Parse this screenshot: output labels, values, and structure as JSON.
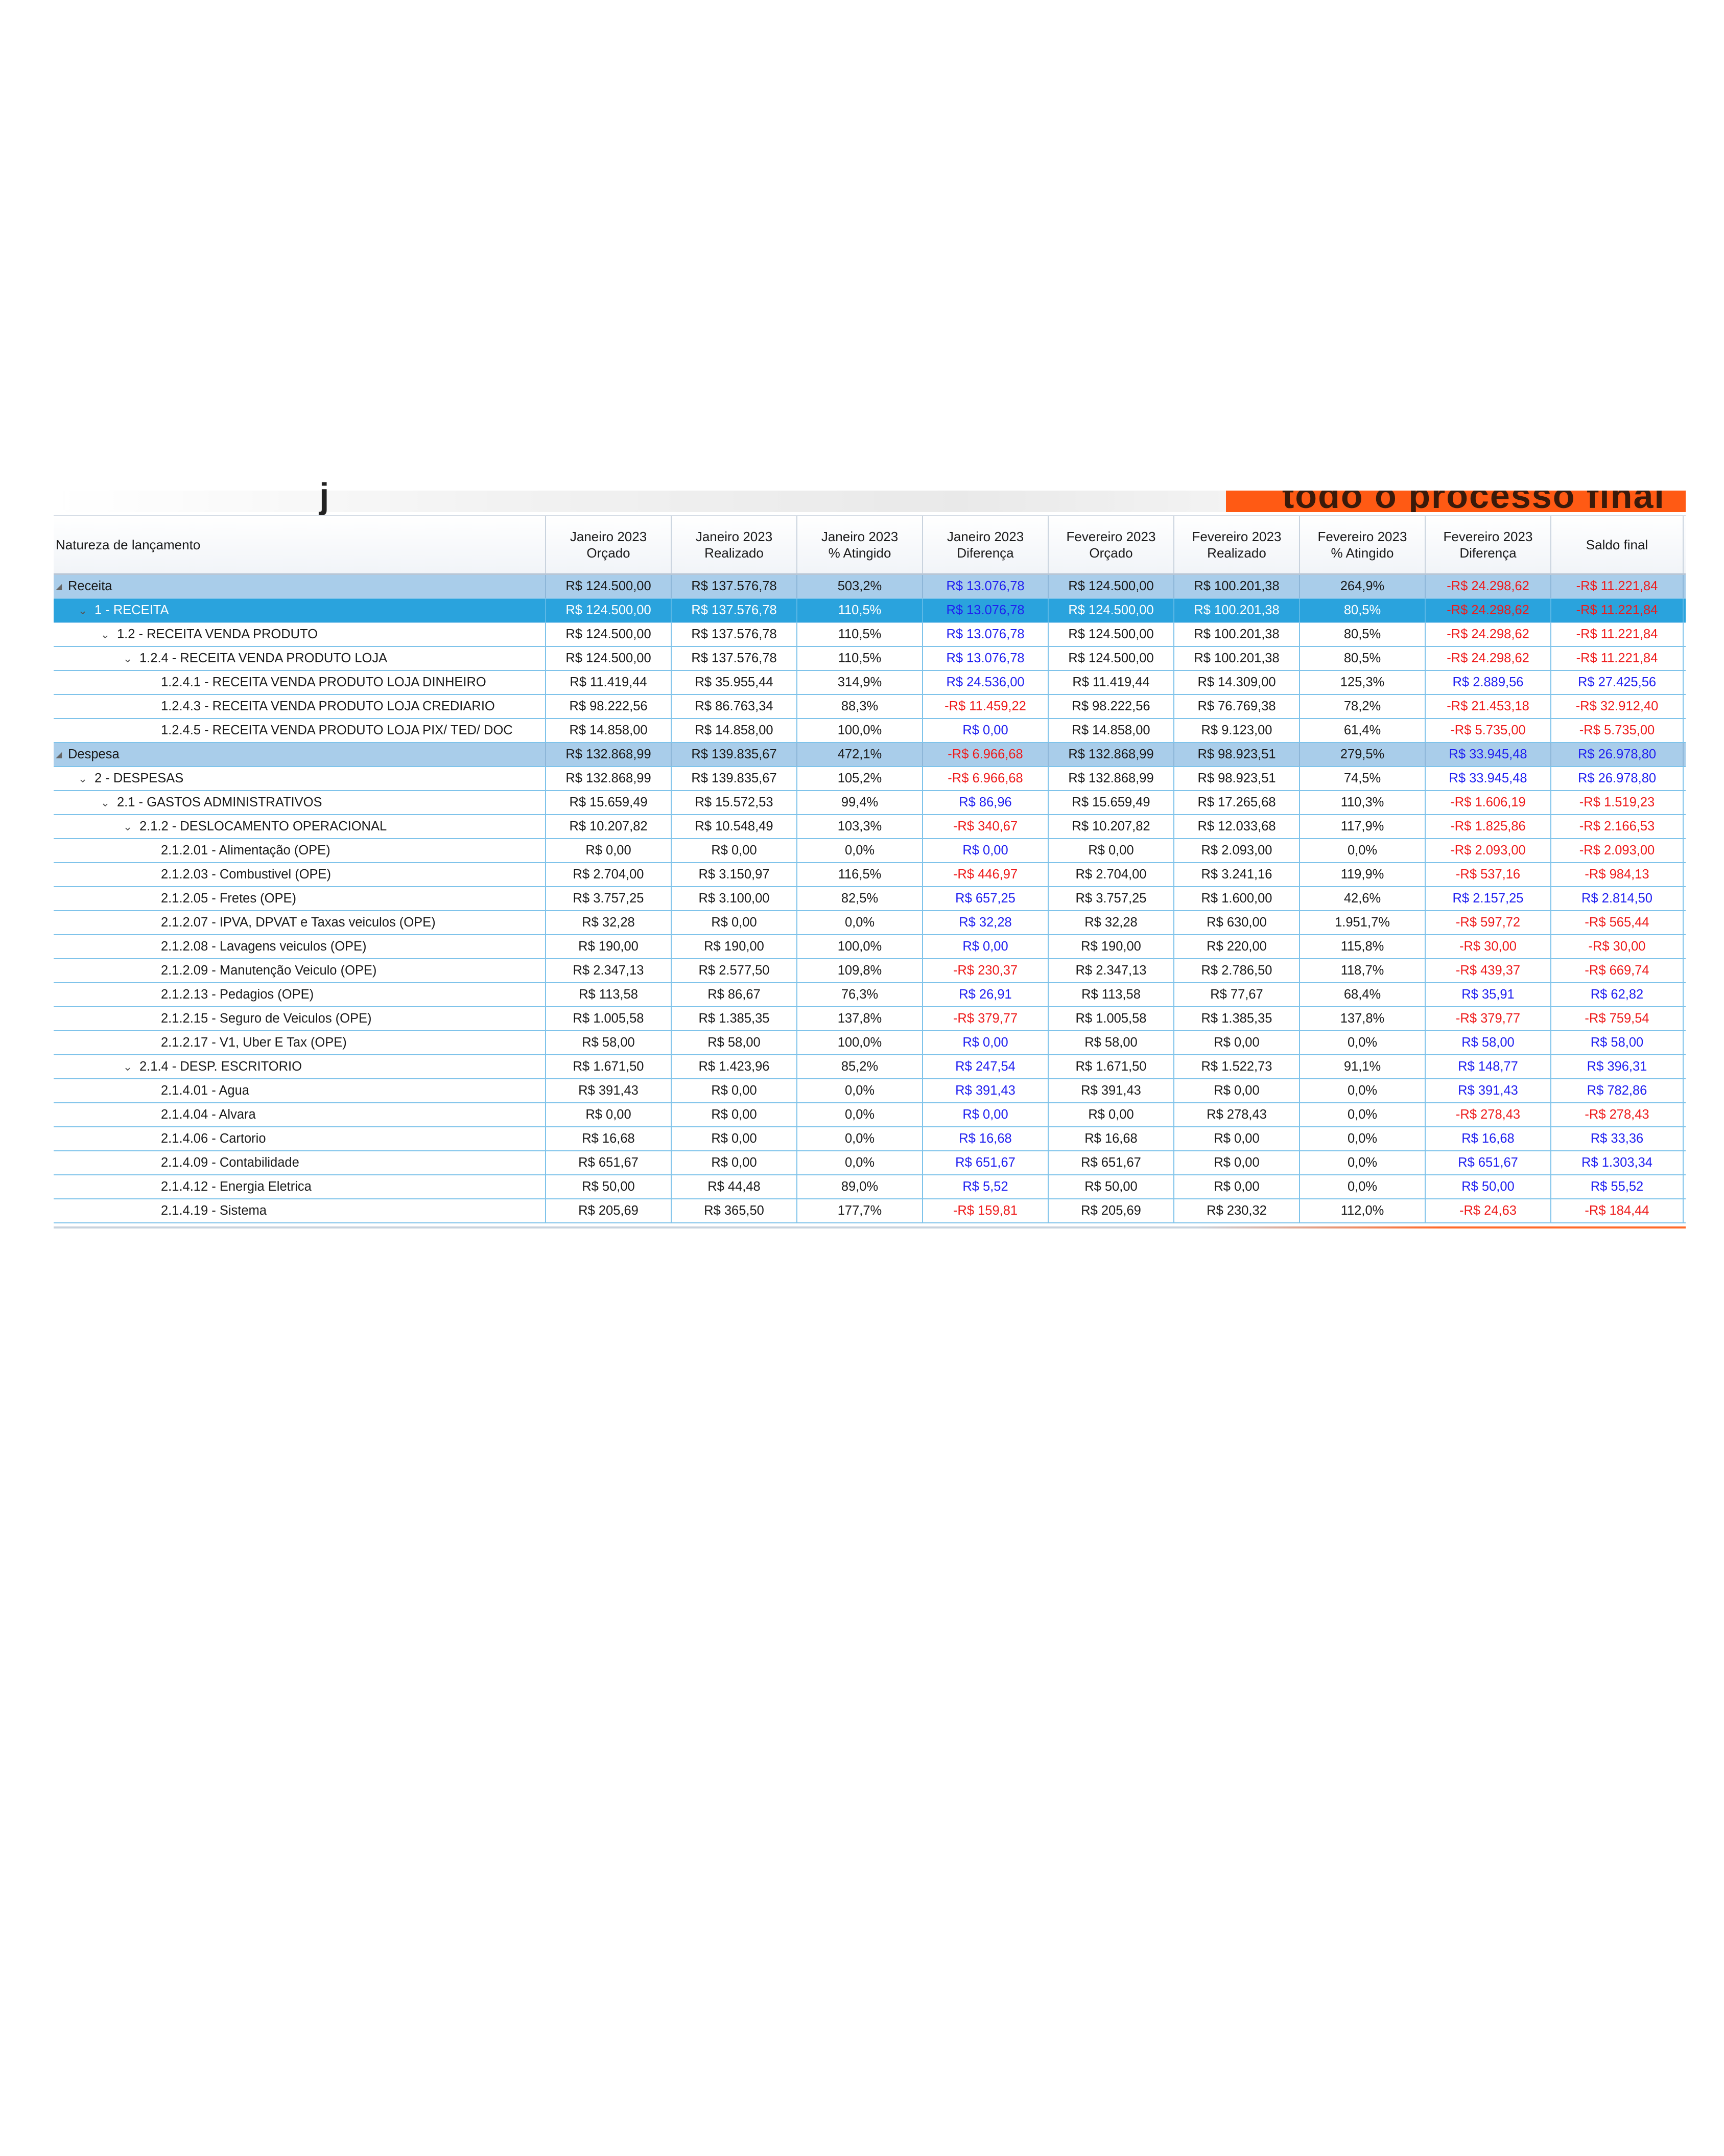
{
  "banner": {
    "partial_text": "todo o processo final"
  },
  "columns": [
    "Natureza de lançamento",
    "Janeiro 2023\nOrçado",
    "Janeiro 2023\nRealizado",
    "Janeiro 2023\n% Atingido",
    "Janeiro 2023\nDiferença",
    "Fevereiro 2023\nOrçado",
    "Fevereiro 2023\nRealizado",
    "Fevereiro 2023\n% Atingido",
    "Fevereiro 2023\nDiferença",
    "Saldo final"
  ],
  "rows": [
    {
      "label": "Receita",
      "level": 0,
      "type": "group",
      "values": [
        "R$ 124.500,00",
        "R$ 137.576,78",
        "503,2%",
        "R$ 13.076,78",
        "R$ 124.500,00",
        "R$ 100.201,38",
        "264,9%",
        "-R$ 24.298,62",
        "-R$ 11.221,84"
      ]
    },
    {
      "label": "1 - RECEITA",
      "level": 1,
      "type": "selected",
      "values": [
        "R$ 124.500,00",
        "R$ 137.576,78",
        "110,5%",
        "R$ 13.076,78",
        "R$ 124.500,00",
        "R$ 100.201,38",
        "80,5%",
        "-R$ 24.298,62",
        "-R$ 11.221,84"
      ]
    },
    {
      "label": "1.2 - RECEITA  VENDA PRODUTO",
      "level": 2,
      "type": "node",
      "values": [
        "R$ 124.500,00",
        "R$ 137.576,78",
        "110,5%",
        "R$ 13.076,78",
        "R$ 124.500,00",
        "R$ 100.201,38",
        "80,5%",
        "-R$ 24.298,62",
        "-R$ 11.221,84"
      ]
    },
    {
      "label": "1.2.4 - RECEITA VENDA PRODUTO LOJA",
      "level": 3,
      "type": "node",
      "values": [
        "R$ 124.500,00",
        "R$ 137.576,78",
        "110,5%",
        "R$ 13.076,78",
        "R$ 124.500,00",
        "R$ 100.201,38",
        "80,5%",
        "-R$ 24.298,62",
        "-R$ 11.221,84"
      ]
    },
    {
      "label": "1.2.4.1 - RECEITA VENDA PRODUTO LOJA DINHEIRO",
      "level": 4,
      "type": "leaf",
      "values": [
        "R$ 11.419,44",
        "R$ 35.955,44",
        "314,9%",
        "R$ 24.536,00",
        "R$ 11.419,44",
        "R$ 14.309,00",
        "125,3%",
        "R$ 2.889,56",
        "R$ 27.425,56"
      ]
    },
    {
      "label": "1.2.4.3 - RECEITA VENDA PRODUTO LOJA CREDIARIO",
      "level": 4,
      "type": "leaf",
      "values": [
        "R$ 98.222,56",
        "R$ 86.763,34",
        "88,3%",
        "-R$ 11.459,22",
        "R$ 98.222,56",
        "R$ 76.769,38",
        "78,2%",
        "-R$ 21.453,18",
        "-R$ 32.912,40"
      ]
    },
    {
      "label": "1.2.4.5 - RECEITA VENDA PRODUTO LOJA PIX/ TED/ DOC",
      "level": 4,
      "type": "leaf",
      "values": [
        "R$ 14.858,00",
        "R$ 14.858,00",
        "100,0%",
        "R$ 0,00",
        "R$ 14.858,00",
        "R$ 9.123,00",
        "61,4%",
        "-R$ 5.735,00",
        "-R$ 5.735,00"
      ]
    },
    {
      "label": "Despesa",
      "level": 0,
      "type": "group",
      "values": [
        "R$ 132.868,99",
        "R$ 139.835,67",
        "472,1%",
        "-R$ 6.966,68",
        "R$ 132.868,99",
        "R$ 98.923,51",
        "279,5%",
        "R$ 33.945,48",
        "R$ 26.978,80"
      ]
    },
    {
      "label": "2 - DESPESAS",
      "level": 1,
      "type": "node",
      "values": [
        "R$ 132.868,99",
        "R$ 139.835,67",
        "105,2%",
        "-R$ 6.966,68",
        "R$ 132.868,99",
        "R$ 98.923,51",
        "74,5%",
        "R$ 33.945,48",
        "R$ 26.978,80"
      ]
    },
    {
      "label": "2.1 - GASTOS ADMINISTRATIVOS",
      "level": 2,
      "type": "node",
      "values": [
        "R$ 15.659,49",
        "R$ 15.572,53",
        "99,4%",
        "R$ 86,96",
        "R$ 15.659,49",
        "R$ 17.265,68",
        "110,3%",
        "-R$ 1.606,19",
        "-R$ 1.519,23"
      ]
    },
    {
      "label": "2.1.2 - DESLOCAMENTO OPERACIONAL",
      "level": 3,
      "type": "node",
      "values": [
        "R$ 10.207,82",
        "R$ 10.548,49",
        "103,3%",
        "-R$ 340,67",
        "R$ 10.207,82",
        "R$ 12.033,68",
        "117,9%",
        "-R$ 1.825,86",
        "-R$ 2.166,53"
      ]
    },
    {
      "label": "2.1.2.01 - Alimentação (OPE)",
      "level": 4,
      "type": "leaf",
      "values": [
        "R$ 0,00",
        "R$ 0,00",
        "0,0%",
        "R$ 0,00",
        "R$ 0,00",
        "R$ 2.093,00",
        "0,0%",
        "-R$ 2.093,00",
        "-R$ 2.093,00"
      ]
    },
    {
      "label": "2.1.2.03 - Combustivel (OPE)",
      "level": 4,
      "type": "leaf",
      "values": [
        "R$ 2.704,00",
        "R$ 3.150,97",
        "116,5%",
        "-R$ 446,97",
        "R$ 2.704,00",
        "R$ 3.241,16",
        "119,9%",
        "-R$ 537,16",
        "-R$ 984,13"
      ]
    },
    {
      "label": "2.1.2.05 - Fretes (OPE)",
      "level": 4,
      "type": "leaf",
      "values": [
        "R$ 3.757,25",
        "R$ 3.100,00",
        "82,5%",
        "R$ 657,25",
        "R$ 3.757,25",
        "R$ 1.600,00",
        "42,6%",
        "R$ 2.157,25",
        "R$ 2.814,50"
      ]
    },
    {
      "label": "2.1.2.07 - IPVA, DPVAT e Taxas veiculos (OPE)",
      "level": 4,
      "type": "leaf",
      "values": [
        "R$ 32,28",
        "R$ 0,00",
        "0,0%",
        "R$ 32,28",
        "R$ 32,28",
        "R$ 630,00",
        "1.951,7%",
        "-R$ 597,72",
        "-R$ 565,44"
      ]
    },
    {
      "label": "2.1.2.08 - Lavagens veiculos (OPE)",
      "level": 4,
      "type": "leaf",
      "values": [
        "R$ 190,00",
        "R$ 190,00",
        "100,0%",
        "R$ 0,00",
        "R$ 190,00",
        "R$ 220,00",
        "115,8%",
        "-R$ 30,00",
        "-R$ 30,00"
      ]
    },
    {
      "label": "2.1.2.09 - Manutenção Veiculo (OPE)",
      "level": 4,
      "type": "leaf",
      "values": [
        "R$ 2.347,13",
        "R$ 2.577,50",
        "109,8%",
        "-R$ 230,37",
        "R$ 2.347,13",
        "R$ 2.786,50",
        "118,7%",
        "-R$ 439,37",
        "-R$ 669,74"
      ]
    },
    {
      "label": "2.1.2.13 - Pedagios (OPE)",
      "level": 4,
      "type": "leaf",
      "values": [
        "R$ 113,58",
        "R$ 86,67",
        "76,3%",
        "R$ 26,91",
        "R$ 113,58",
        "R$ 77,67",
        "68,4%",
        "R$ 35,91",
        "R$ 62,82"
      ]
    },
    {
      "label": "2.1.2.15 - Seguro de Veiculos (OPE)",
      "level": 4,
      "type": "leaf",
      "values": [
        "R$ 1.005,58",
        "R$ 1.385,35",
        "137,8%",
        "-R$ 379,77",
        "R$ 1.005,58",
        "R$ 1.385,35",
        "137,8%",
        "-R$ 379,77",
        "-R$ 759,54"
      ]
    },
    {
      "label": "2.1.2.17 - V1, Uber E Tax (OPE)",
      "level": 4,
      "type": "leaf",
      "values": [
        "R$ 58,00",
        "R$ 58,00",
        "100,0%",
        "R$ 0,00",
        "R$ 58,00",
        "R$ 0,00",
        "0,0%",
        "R$ 58,00",
        "R$ 58,00"
      ]
    },
    {
      "label": "2.1.4 - DESP. ESCRITORIO",
      "level": 3,
      "type": "node",
      "values": [
        "R$ 1.671,50",
        "R$ 1.423,96",
        "85,2%",
        "R$ 247,54",
        "R$ 1.671,50",
        "R$ 1.522,73",
        "91,1%",
        "R$ 148,77",
        "R$ 396,31"
      ]
    },
    {
      "label": "2.1.4.01 - Agua",
      "level": 4,
      "type": "leaf",
      "values": [
        "R$ 391,43",
        "R$ 0,00",
        "0,0%",
        "R$ 391,43",
        "R$ 391,43",
        "R$ 0,00",
        "0,0%",
        "R$ 391,43",
        "R$ 782,86"
      ]
    },
    {
      "label": "2.1.4.04 - Alvara",
      "level": 4,
      "type": "leaf",
      "values": [
        "R$ 0,00",
        "R$ 0,00",
        "0,0%",
        "R$ 0,00",
        "R$ 0,00",
        "R$ 278,43",
        "0,0%",
        "-R$ 278,43",
        "-R$ 278,43"
      ]
    },
    {
      "label": "2.1.4.06 - Cartorio",
      "level": 4,
      "type": "leaf",
      "values": [
        "R$ 16,68",
        "R$ 0,00",
        "0,0%",
        "R$ 16,68",
        "R$ 16,68",
        "R$ 0,00",
        "0,0%",
        "R$ 16,68",
        "R$ 33,36"
      ]
    },
    {
      "label": "2.1.4.09 - Contabilidade",
      "level": 4,
      "type": "leaf",
      "values": [
        "R$ 651,67",
        "R$ 0,00",
        "0,0%",
        "R$ 651,67",
        "R$ 651,67",
        "R$ 0,00",
        "0,0%",
        "R$ 651,67",
        "R$ 1.303,34"
      ]
    },
    {
      "label": "2.1.4.12 - Energia Eletrica",
      "level": 4,
      "type": "leaf",
      "values": [
        "R$ 50,00",
        "R$ 44,48",
        "89,0%",
        "R$ 5,52",
        "R$ 50,00",
        "R$ 0,00",
        "0,0%",
        "R$ 50,00",
        "R$ 55,52"
      ]
    },
    {
      "label": "2.1.4.19 - Sistema",
      "level": 4,
      "type": "leaf",
      "values": [
        "R$ 205,69",
        "R$ 365,50",
        "177,7%",
        "-R$ 159,81",
        "R$ 205,69",
        "R$ 230,32",
        "112,0%",
        "-R$ 24,63",
        "-R$ 184,44"
      ]
    }
  ]
}
